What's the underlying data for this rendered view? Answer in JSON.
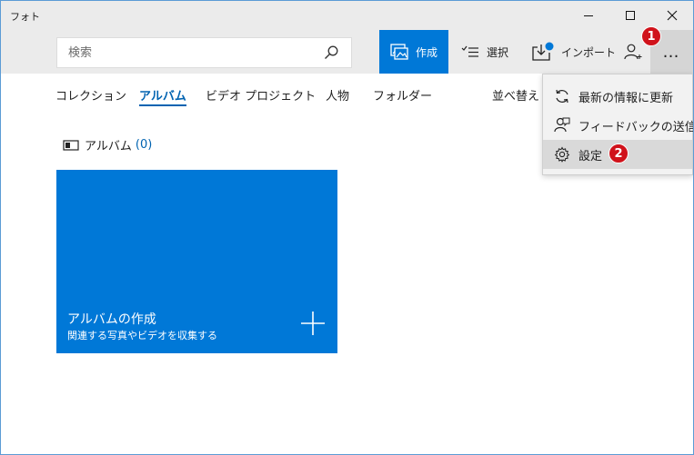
{
  "window": {
    "title": "フォト"
  },
  "search": {
    "placeholder": "検索"
  },
  "toolbar": {
    "create_label": "作成",
    "select_label": "選択",
    "import_label": "インポート",
    "more_label": "…"
  },
  "badges": {
    "first": "1",
    "second": "2"
  },
  "nav": {
    "tabs": [
      {
        "label": "コレクション"
      },
      {
        "label": "アルバム"
      },
      {
        "label": "ビデオ プロジェクト"
      },
      {
        "label": "人物"
      },
      {
        "label": "フォルダー"
      }
    ],
    "sort_label": "並べ替え"
  },
  "section": {
    "title": "アルバム",
    "count": "(0)"
  },
  "tile": {
    "title": "アルバムの作成",
    "subtitle": "関連する写真やビデオを収集する"
  },
  "menu": {
    "items": [
      {
        "label": "最新の情報に更新",
        "icon": "refresh-icon"
      },
      {
        "label": "フィードバックの送信",
        "icon": "feedback-icon"
      },
      {
        "label": "設定",
        "icon": "gear-icon"
      }
    ]
  },
  "colors": {
    "accent": "#0078d7",
    "badge": "#d0121b",
    "active_tab": "#0063b1",
    "toolbar_bg": "#ebebeb",
    "menu_bg": "#f2f2f2"
  }
}
